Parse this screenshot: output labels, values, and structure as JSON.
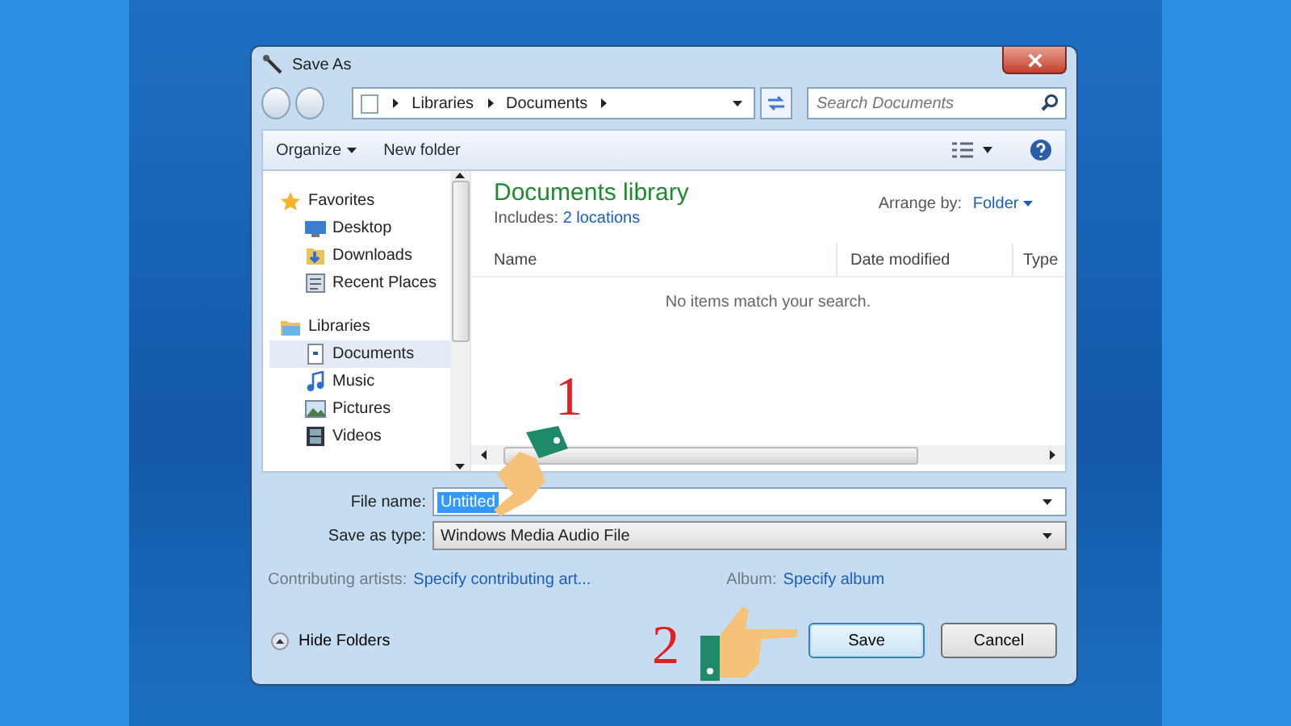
{
  "window": {
    "title": "Save As"
  },
  "address_bar": {
    "breadcrumbs": [
      "Libraries",
      "Documents"
    ]
  },
  "search": {
    "placeholder": "Search Documents"
  },
  "toolbar": {
    "buttons": [
      {
        "label": "Organize",
        "dropdown": true
      },
      {
        "label": "New folder",
        "dropdown": false
      }
    ]
  },
  "sidebar": {
    "groups": [
      {
        "label": "Favorites",
        "children": [
          {
            "label": "Desktop",
            "selected": false
          },
          {
            "label": "Downloads",
            "selected": false
          },
          {
            "label": "Recent Places",
            "selected": false
          }
        ]
      },
      {
        "label": "Libraries",
        "children": [
          {
            "label": "Documents",
            "selected": true
          },
          {
            "label": "Music",
            "selected": false
          },
          {
            "label": "Pictures",
            "selected": false
          },
          {
            "label": "Videos",
            "selected": false
          }
        ]
      }
    ]
  },
  "library": {
    "title": "Documents library",
    "includes_label": "Includes:",
    "includes_link": "2 locations",
    "arrange_label": "Arrange by:",
    "arrange_value": "Folder"
  },
  "table": {
    "columns": [
      "Name",
      "Date modified",
      "Type"
    ],
    "empty_message": "No items match your search."
  },
  "form": {
    "fields": [
      {
        "label": "File name:",
        "value": "Untitled",
        "kind": "combo",
        "text_selected": true
      },
      {
        "label": "Save as type:",
        "value": "Windows Media Audio File",
        "kind": "select",
        "text_selected": false
      }
    ]
  },
  "metadata": [
    {
      "label": "Contributing artists:",
      "value": "Specify contributing art..."
    },
    {
      "label": "Album:",
      "value": "Specify album"
    }
  ],
  "hide_folders": "Hide Folders",
  "buttons": [
    {
      "label": "Save",
      "default": true
    },
    {
      "label": "Cancel",
      "default": false
    }
  ],
  "annotations": [
    {
      "label": "1"
    },
    {
      "label": "2"
    }
  ]
}
